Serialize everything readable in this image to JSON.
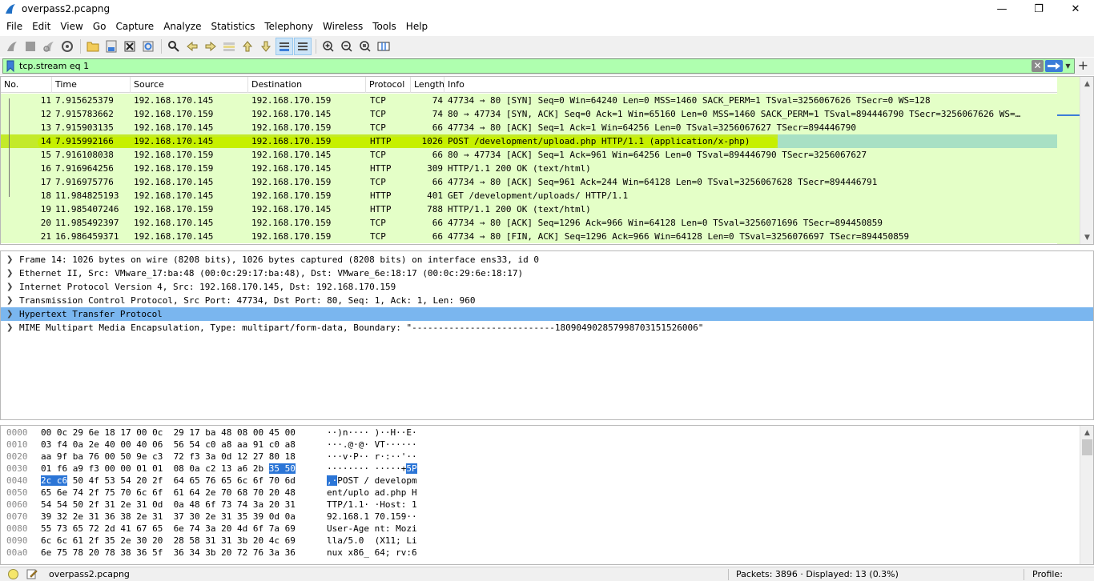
{
  "window": {
    "title": "overpass2.pcapng",
    "minimize": "—",
    "restore": "❐",
    "close": "✕"
  },
  "menu": [
    "File",
    "Edit",
    "View",
    "Go",
    "Capture",
    "Analyze",
    "Statistics",
    "Telephony",
    "Wireless",
    "Tools",
    "Help"
  ],
  "filter": {
    "value": "tcp.stream eq 1",
    "clear_glyph": "✕",
    "plus_glyph": "+",
    "dropdown_glyph": "▼"
  },
  "packet_list": {
    "columns": [
      "No.",
      "Time",
      "Source",
      "Destination",
      "Protocol",
      "Length",
      "Info"
    ],
    "rows": [
      {
        "no": "11",
        "time": "7.915625379",
        "src": "192.168.170.145",
        "dst": "192.168.170.159",
        "proto": "TCP",
        "len": "74",
        "info": "47734 → 80 [SYN] Seq=0 Win=64240 Len=0 MSS=1460 SACK_PERM=1 TSval=3256067626 TSecr=0 WS=128"
      },
      {
        "no": "12",
        "time": "7.915783662",
        "src": "192.168.170.159",
        "dst": "192.168.170.145",
        "proto": "TCP",
        "len": "74",
        "info": "80 → 47734 [SYN, ACK] Seq=0 Ack=1 Win=65160 Len=0 MSS=1460 SACK_PERM=1 TSval=894446790 TSecr=3256067626 WS=…"
      },
      {
        "no": "13",
        "time": "7.915903135",
        "src": "192.168.170.145",
        "dst": "192.168.170.159",
        "proto": "TCP",
        "len": "66",
        "info": "47734 → 80 [ACK] Seq=1 Ack=1 Win=64256 Len=0 TSval=3256067627 TSecr=894446790"
      },
      {
        "no": "14",
        "time": "7.915992166",
        "src": "192.168.170.145",
        "dst": "192.168.170.159",
        "proto": "HTTP",
        "len": "1026",
        "info": "POST /development/upload.php HTTP/1.1  (application/x-php)"
      },
      {
        "no": "15",
        "time": "7.916108038",
        "src": "192.168.170.159",
        "dst": "192.168.170.145",
        "proto": "TCP",
        "len": "66",
        "info": "80 → 47734 [ACK] Seq=1 Ack=961 Win=64256 Len=0 TSval=894446790 TSecr=3256067627"
      },
      {
        "no": "16",
        "time": "7.916964256",
        "src": "192.168.170.159",
        "dst": "192.168.170.145",
        "proto": "HTTP",
        "len": "309",
        "info": "HTTP/1.1 200 OK  (text/html)"
      },
      {
        "no": "17",
        "time": "7.916975776",
        "src": "192.168.170.145",
        "dst": "192.168.170.159",
        "proto": "TCP",
        "len": "66",
        "info": "47734 → 80 [ACK] Seq=961 Ack=244 Win=64128 Len=0 TSval=3256067628 TSecr=894446791"
      },
      {
        "no": "18",
        "time": "11.984825193",
        "src": "192.168.170.145",
        "dst": "192.168.170.159",
        "proto": "HTTP",
        "len": "401",
        "info": "GET /development/uploads/ HTTP/1.1"
      },
      {
        "no": "19",
        "time": "11.985407246",
        "src": "192.168.170.159",
        "dst": "192.168.170.145",
        "proto": "HTTP",
        "len": "788",
        "info": "HTTP/1.1 200 OK  (text/html)"
      },
      {
        "no": "20",
        "time": "11.985492397",
        "src": "192.168.170.145",
        "dst": "192.168.170.159",
        "proto": "TCP",
        "len": "66",
        "info": "47734 → 80 [ACK] Seq=1296 Ack=966 Win=64128 Len=0 TSval=3256071696 TSecr=894450859"
      },
      {
        "no": "21",
        "time": "16.986459371",
        "src": "192.168.170.145",
        "dst": "192.168.170.159",
        "proto": "TCP",
        "len": "66",
        "info": "47734 → 80 [FIN, ACK] Seq=1296 Ack=966 Win=64128 Len=0 TSval=3256076697 TSecr=894450859"
      }
    ],
    "selected_no": "14"
  },
  "details": [
    "Frame 14: 1026 bytes on wire (8208 bits), 1026 bytes captured (8208 bits) on interface ens33, id 0",
    "Ethernet II, Src: VMware_17:ba:48 (00:0c:29:17:ba:48), Dst: VMware_6e:18:17 (00:0c:29:6e:18:17)",
    "Internet Protocol Version 4, Src: 192.168.170.145, Dst: 192.168.170.159",
    "Transmission Control Protocol, Src Port: 47734, Dst Port: 80, Seq: 1, Ack: 1, Len: 960",
    "Hypertext Transfer Protocol",
    "MIME Multipart Media Encapsulation, Type: multipart/form-data, Boundary: \"---------------------------180904902857998703151526006\""
  ],
  "details_selected_index": 4,
  "bytes": [
    {
      "off": "0000",
      "hex": "00 0c 29 6e 18 17 00 0c  29 17 ba 48 08 00 45 00",
      "asc": "··)n···· )··H··E·"
    },
    {
      "off": "0010",
      "hex": "03 f4 0a 2e 40 00 40 06  56 54 c0 a8 aa 91 c0 a8",
      "asc": "···.@·@· VT······"
    },
    {
      "off": "0020",
      "hex": "aa 9f ba 76 00 50 9e c3  72 f3 3a 0d 12 27 80 18",
      "asc": "···v·P·· r·:··'··"
    },
    {
      "off": "0030",
      "hex_pre": "01 f6 a9 f3 00 00 01 01  08 0a c2 13 a6 2b ",
      "hex_hl": "35 50",
      "asc_pre": "········ ·····+",
      "asc_hl": "5P"
    },
    {
      "off": "0040",
      "hex_hl": "2c c6",
      "hex_post": " 50 4f 53 54 20 2f  64 65 76 65 6c 6f 70 6d",
      "asc_hl": ",·",
      "asc_post": "POST / developm"
    },
    {
      "off": "0050",
      "hex": "65 6e 74 2f 75 70 6c 6f  61 64 2e 70 68 70 20 48",
      "asc": "ent/uplo ad.php H"
    },
    {
      "off": "0060",
      "hex": "54 54 50 2f 31 2e 31 0d  0a 48 6f 73 74 3a 20 31",
      "asc": "TTP/1.1· ·Host: 1"
    },
    {
      "off": "0070",
      "hex": "39 32 2e 31 36 38 2e 31  37 30 2e 31 35 39 0d 0a",
      "asc": "92.168.1 70.159··"
    },
    {
      "off": "0080",
      "hex": "55 73 65 72 2d 41 67 65  6e 74 3a 20 4d 6f 7a 69",
      "asc": "User-Age nt: Mozi"
    },
    {
      "off": "0090",
      "hex": "6c 6c 61 2f 35 2e 30 20  28 58 31 31 3b 20 4c 69",
      "asc": "lla/5.0  (X11; Li"
    },
    {
      "off": "00a0",
      "hex": "6e 75 78 20 78 38 36 5f  36 34 3b 20 72 76 3a 36",
      "asc": "nux x86_ 64; rv:6"
    }
  ],
  "status": {
    "file": "overpass2.pcapng",
    "packets": "Packets: 3896 · Displayed: 13 (0.3%)",
    "profile": "Profile: Default"
  },
  "colors": {
    "tcp_row": "#e4ffc7",
    "selected_row": "#c3ea2a",
    "filter_valid": "#afffaf",
    "selected_detail": "#7ab6ef",
    "byte_highlight": "#2b75d6"
  }
}
